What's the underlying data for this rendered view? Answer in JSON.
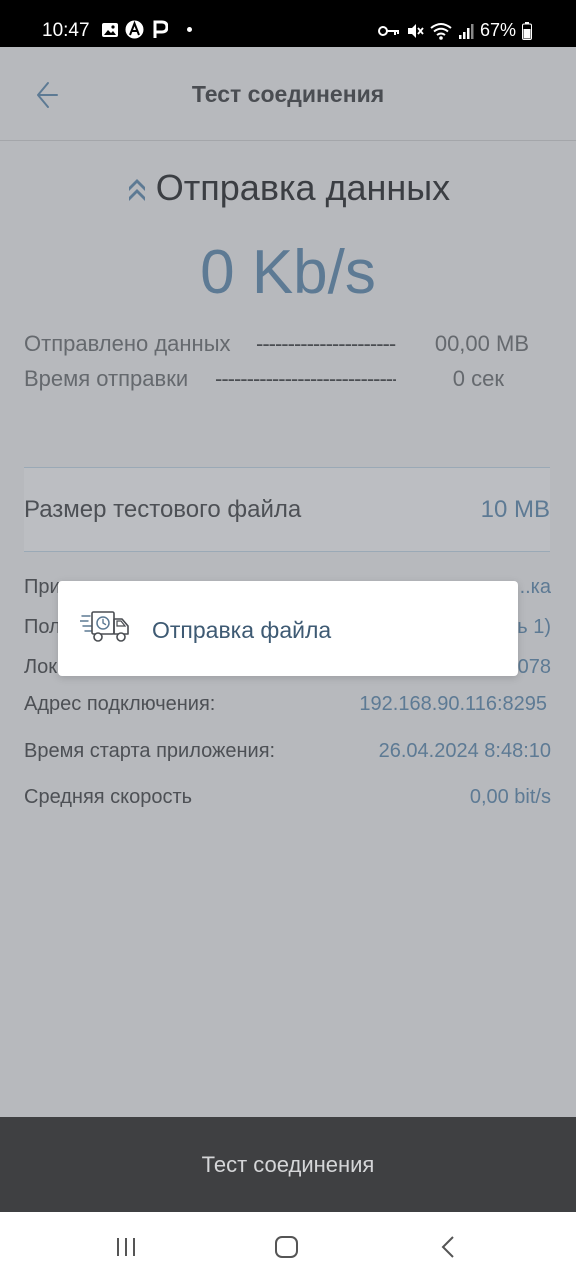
{
  "status_bar": {
    "time": "10:47",
    "battery": "67%"
  },
  "app_bar": {
    "title": "Тест соединения"
  },
  "upload": {
    "title": "Отправка данных",
    "speed": "0 Kb/s",
    "sent_label": "Отправлено данных",
    "sent_value": "00,00 MB",
    "time_label": "Время отправки",
    "time_value": "0 сек"
  },
  "file_size": {
    "label": "Размер тестового файла",
    "value": "10 MB"
  },
  "info": [
    {
      "label": "При",
      "value": "...ка"
    },
    {
      "label": "Пол",
      "value": "ь 1)"
    },
    {
      "label": "Лок",
      "value": "078"
    },
    {
      "label": "Адрес подключения:",
      "value": "192.168.90.116:8295"
    },
    {
      "label": "Время старта приложения:",
      "value": "26.04.2024 8:48:10"
    },
    {
      "label": "Средняя скорость",
      "value": "0,00 bit/s"
    }
  ],
  "dialog": {
    "text": "Отправка файла",
    "icon": "delivery-truck-icon"
  },
  "bottom_button": {
    "label": "Тест соединения"
  },
  "colors": {
    "accent": "#5d7a94",
    "overlay": "#b7b9bd",
    "bottom_button": "#3f4042"
  }
}
